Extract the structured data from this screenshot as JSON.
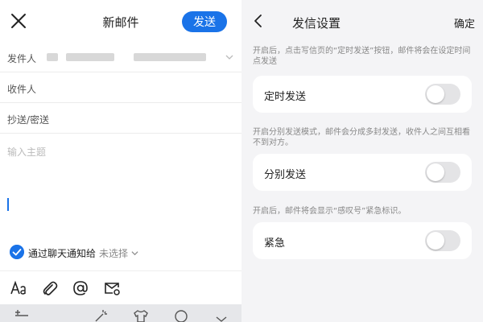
{
  "compose": {
    "title": "新邮件",
    "send_label": "发送",
    "sender_label": "发件人",
    "recipient_label": "收件人",
    "cc_label": "抄送/密送",
    "subject_placeholder": "输入主题",
    "notify_label": "通过聊天通知给",
    "notify_value": "未选择"
  },
  "settings": {
    "title": "发信设置",
    "confirm_label": "确定",
    "scheduled": {
      "hint": "开启后，点击写信页的“定时发送”按钮，邮件将会在设定时间点发送",
      "label": "定时发送",
      "enabled": false
    },
    "separate": {
      "hint": "开启分别发送模式，邮件会分成多封发送，收件人之间互相看不到对方。",
      "label": "分别发送",
      "enabled": false
    },
    "urgent": {
      "hint": "开启后，邮件将会显示“感叹号”紧急标识。",
      "label": "紧急",
      "enabled": false
    }
  },
  "icons": {
    "close": "close-icon",
    "back": "back-icon",
    "text_format": "text-format-icon",
    "attachment": "attachment-icon",
    "mention": "at-icon",
    "mail_settings": "mail-settings-icon"
  },
  "colors": {
    "accent": "#1a73e8",
    "toggle_off": "#e4e4e6",
    "panel_bg": "#f4f4f6"
  }
}
